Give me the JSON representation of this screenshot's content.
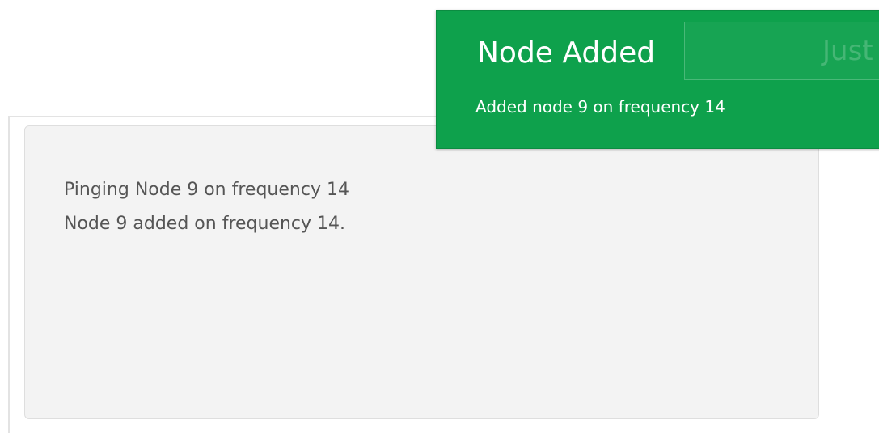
{
  "log": {
    "lines": [
      "Pinging Node 9 on frequency 14",
      "Node 9 added on frequency 14."
    ]
  },
  "toast": {
    "title": "Node Added",
    "message": "Added node 9 on frequency 14",
    "time": "Just n",
    "color": "#0ea14c"
  }
}
